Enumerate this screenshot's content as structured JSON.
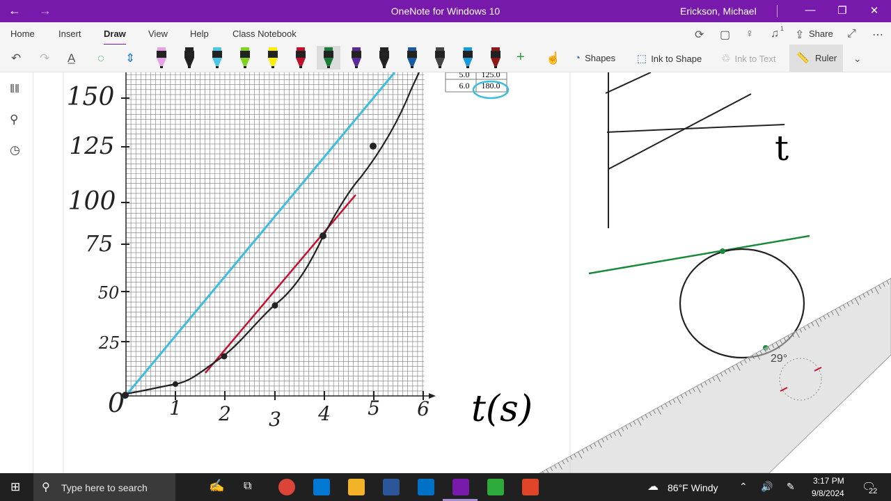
{
  "titlebar": {
    "back": "←",
    "forward": "→",
    "title": "OneNote for Windows 10",
    "user": "Erickson, Michael"
  },
  "tabs": [
    "Home",
    "Insert",
    "Draw",
    "View",
    "Help",
    "Class Notebook"
  ],
  "ribbon_right": {
    "share": "Share",
    "notification_count": "1"
  },
  "toolbar": {
    "shapes": "Shapes",
    "ink_to_shape": "Ink to Shape",
    "ink_to_text": "Ink to Text",
    "ruler": "Ruler"
  },
  "pens": [
    "#e6a0e6",
    "#222222",
    "#4ec6e6",
    "#7ed321",
    "#ffee00",
    "#c0102a",
    "#1a7a3a",
    "#5a2a9a",
    "#222222",
    "#1a5aa0",
    "#444444",
    "#1a9ad6",
    "#8a1a1a"
  ],
  "graph": {
    "y_labels": [
      "150",
      "125",
      "100",
      "75",
      "50",
      "25",
      "0"
    ],
    "x_labels": [
      "1",
      "2",
      "3",
      "4",
      "5",
      "6"
    ],
    "axis_label": "t(s)",
    "table_rows": [
      [
        "5.0",
        "125.0"
      ],
      [
        "6.0",
        "180.0"
      ]
    ]
  },
  "sketch": {
    "axis_label": "t"
  },
  "ruler": {
    "angle": "29°"
  },
  "taskbar": {
    "search": "Type here to search",
    "weather": "86°F  Windy",
    "time": "3:17 PM",
    "date": "9/8/2024",
    "notifications": "22"
  }
}
